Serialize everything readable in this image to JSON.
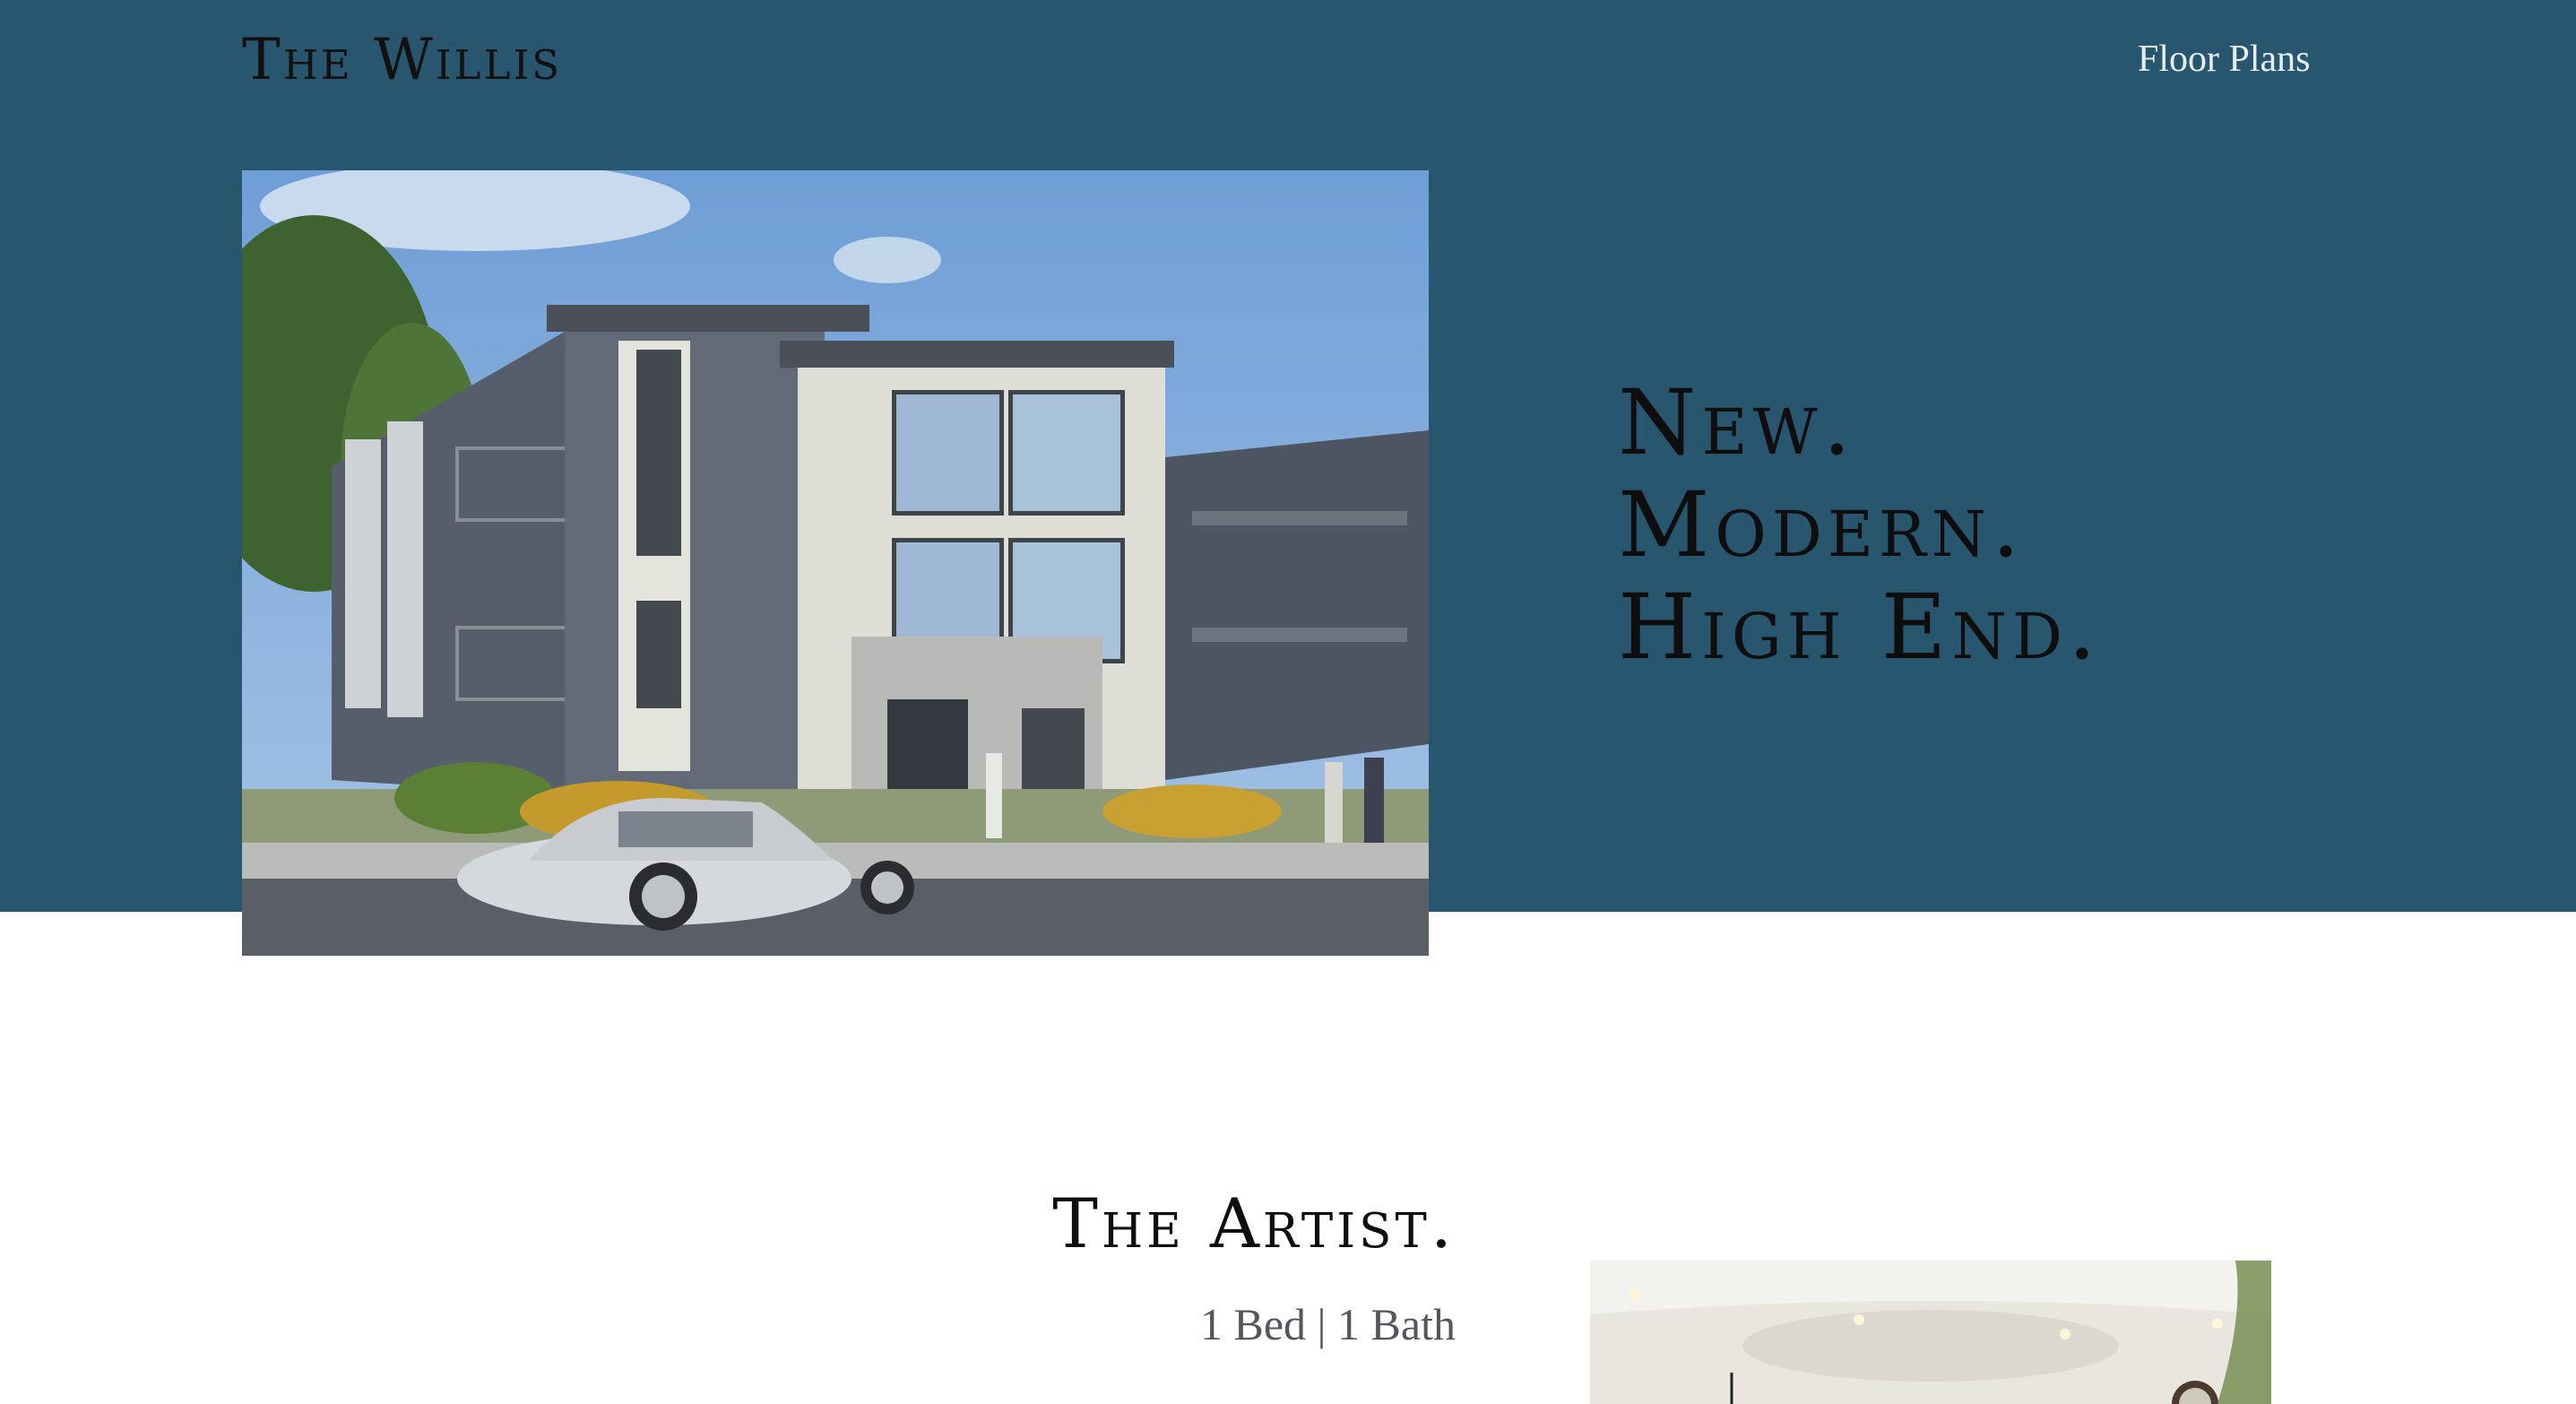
{
  "header": {
    "brand": "The Willis",
    "nav": {
      "floor_plans_label": "Floor Plans"
    }
  },
  "hero": {
    "image_alt": "Rendering of a modern three-story apartment building with a silver car parked in front",
    "tagline_lines": [
      "New.",
      "Modern.",
      "High End."
    ]
  },
  "artist": {
    "title": "The Artist.",
    "specs": "1 Bed | 1 Bath",
    "image_alt": "Interior of a bright living room with recessed ceiling lights and a wall clock"
  },
  "colors": {
    "hero_background": "#28566f",
    "page_background": "#ffffff",
    "heading_text": "#0e0e0e",
    "nav_text": "#e7eef2",
    "specs_text": "#555560"
  }
}
